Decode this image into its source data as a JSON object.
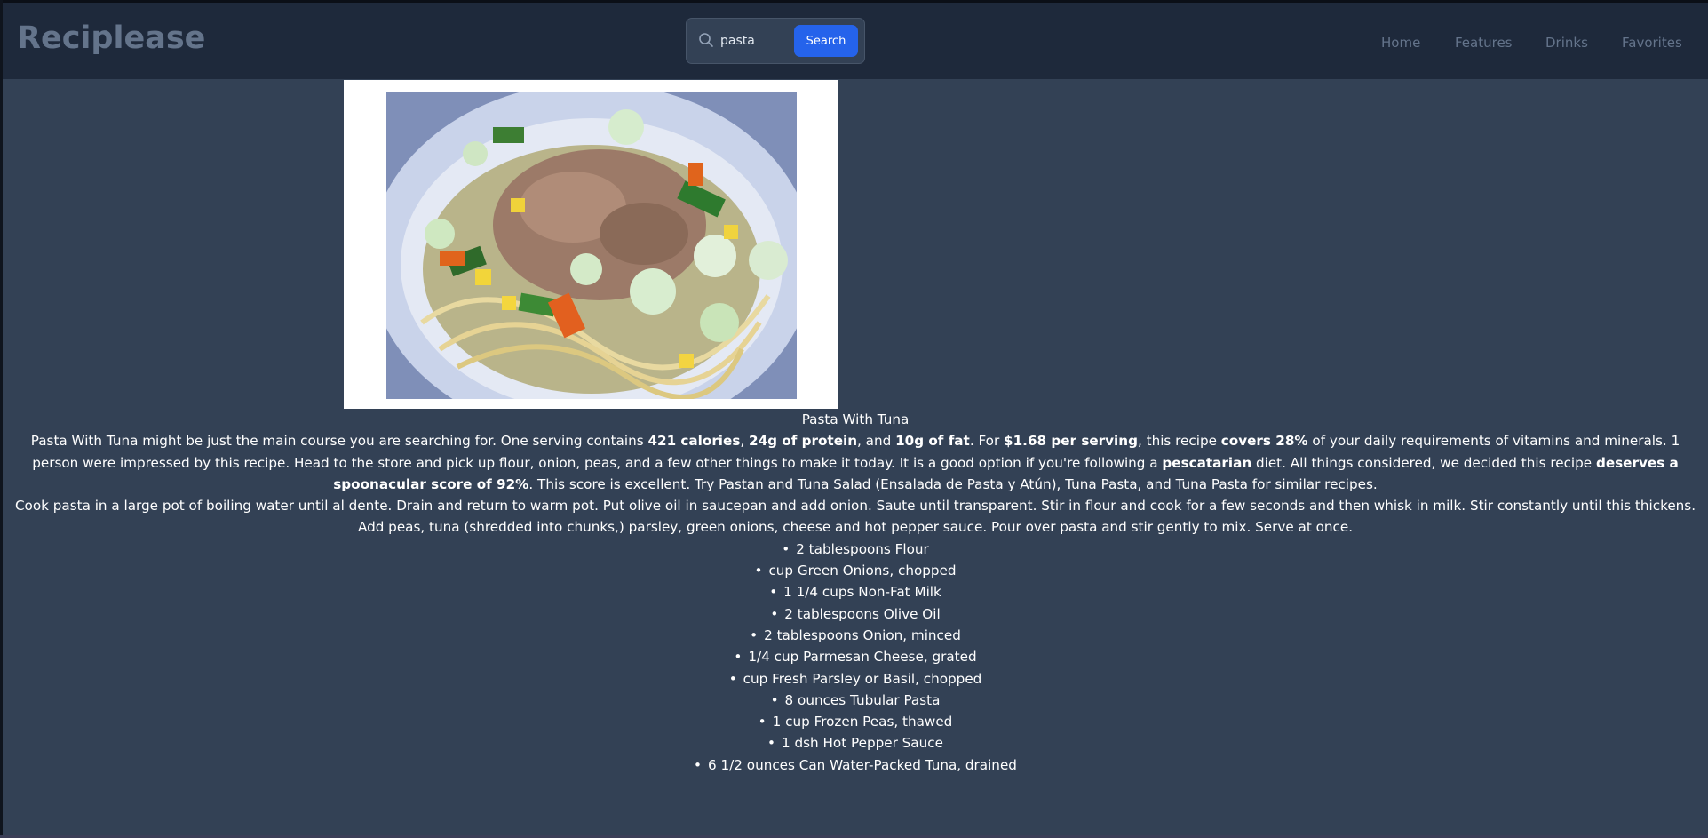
{
  "header": {
    "logo": "Reciplease",
    "search": {
      "value": "pasta",
      "placeholder": "",
      "button_label": "Search"
    },
    "nav": [
      {
        "label": "Home"
      },
      {
        "label": "Features"
      },
      {
        "label": "Drinks"
      },
      {
        "label": "Favorites"
      }
    ]
  },
  "colors": {
    "page_background": "#334155",
    "header_background": "#1e293b",
    "logo": "#64748b",
    "nav_text": "#64748b",
    "search_button": "#2563eb",
    "text": "#ffffff"
  },
  "recipe": {
    "image_alt": "Pasta With Tuna",
    "title": "Pasta With Tuna",
    "summary": {
      "t1": "Pasta With Tuna might be just the main course you are searching for. One serving contains ",
      "b1": "421 calories",
      "t2": ", ",
      "b2": "24g of protein",
      "t3": ", and ",
      "b3": "10g of fat",
      "t4": ". For ",
      "b4": "$1.68 per serving",
      "t5": ", this recipe ",
      "b5": "covers 28%",
      "t6": " of your daily requirements of vitamins and minerals. 1 person were impressed by this recipe. Head to the store and pick up flour, onion, peas, and a few other things to make it today. It is a good option if you're following a ",
      "b6": "pescatarian",
      "t7": " diet. All things considered, we decided this recipe ",
      "b7": "deserves a spoonacular score of 92%",
      "t8": ". This score is excellent. Try Pastan and Tuna Salad (Ensalada de Pasta y Atún), Tuna Pasta, and Tuna Pasta for similar recipes."
    },
    "instructions": "Cook pasta in a large pot of boiling water until al dente. Drain and return to warm pot. Put olive oil in saucepan and add onion. Saute until transparent. Stir in flour and cook for a few seconds and then whisk in milk. Stir constantly until this thickens. Add peas, tuna (shredded into chunks,) parsley, green onions, cheese and hot pepper sauce. Pour over pasta and stir gently to mix. Serve at once.",
    "ingredients": [
      "2 tablespoons Flour",
      "cup Green Onions, chopped",
      "1 1/4 cups Non-Fat Milk",
      "2 tablespoons Olive Oil",
      "2 tablespoons Onion, minced",
      "1/4 cup Parmesan Cheese, grated",
      "cup Fresh Parsley or Basil, chopped",
      "8 ounces Tubular Pasta",
      "1 cup Frozen Peas, thawed",
      "1 dsh Hot Pepper Sauce",
      "6 1/2 ounces Can Water-Packed Tuna, drained"
    ]
  }
}
